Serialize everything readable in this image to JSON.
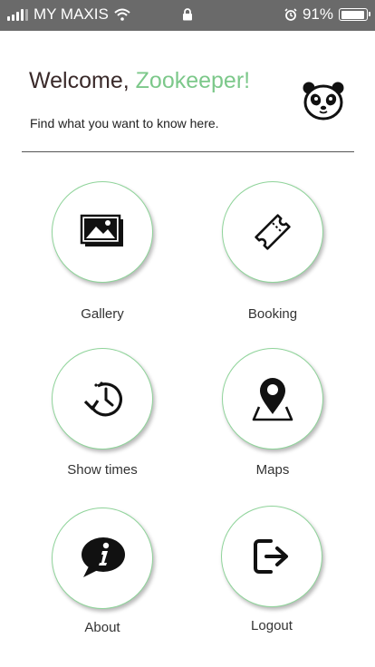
{
  "status_bar": {
    "carrier": "MY MAXIS",
    "battery_percent": "91%",
    "battery_level": 0.91
  },
  "header": {
    "welcome_prefix": "Welcome, ",
    "welcome_name": "Zookeeper!",
    "subtitle": "Find what you want to know here."
  },
  "menu": {
    "gallery": "Gallery",
    "booking": "Booking",
    "show_times": "Show times",
    "maps": "Maps",
    "about": "About",
    "logout": "Logout"
  },
  "colors": {
    "accent": "#7cc88a",
    "status_bar": "#6a6a6a"
  },
  "icons": {
    "gallery": "images-icon",
    "booking": "ticket-icon",
    "show_times": "clock-history-icon",
    "maps": "map-pin-icon",
    "about": "info-speech-icon",
    "logout": "logout-icon",
    "brand": "panda-icon"
  }
}
